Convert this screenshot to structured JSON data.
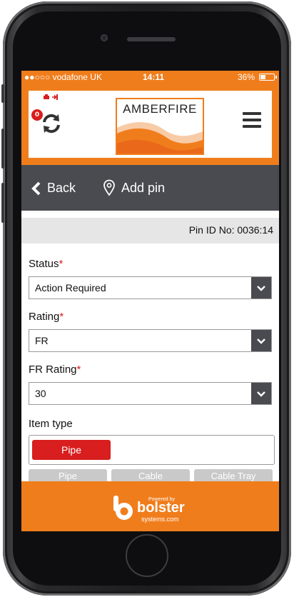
{
  "status_bar": {
    "carrier": "●●○○○ vodafone UK",
    "time": "14:11",
    "battery": "36%"
  },
  "header": {
    "logo_text": "AMBERFIRE",
    "sync_badge_count": "0"
  },
  "nav": {
    "back_label": "Back",
    "add_pin_label": "Add pin"
  },
  "pin": {
    "id_label": "Pin ID No: 0036:14"
  },
  "form": {
    "status": {
      "label": "Status",
      "value": "Action Required"
    },
    "rating": {
      "label": "Rating",
      "value": "FR"
    },
    "fr_rating": {
      "label": "FR Rating",
      "value": "30"
    },
    "item_type": {
      "label": "Item type",
      "selected": "Pipe"
    },
    "required_marker": "*"
  },
  "item_type_options": [
    "Pipe",
    "Cable",
    "Cable Tray"
  ],
  "footer": {
    "powered_by": "Powered by",
    "brand": "bolster",
    "brand_sub": "systems.com"
  },
  "colors": {
    "accent": "#f07d1c",
    "nav_bg": "#4a4b50",
    "required": "#d81e1e"
  }
}
